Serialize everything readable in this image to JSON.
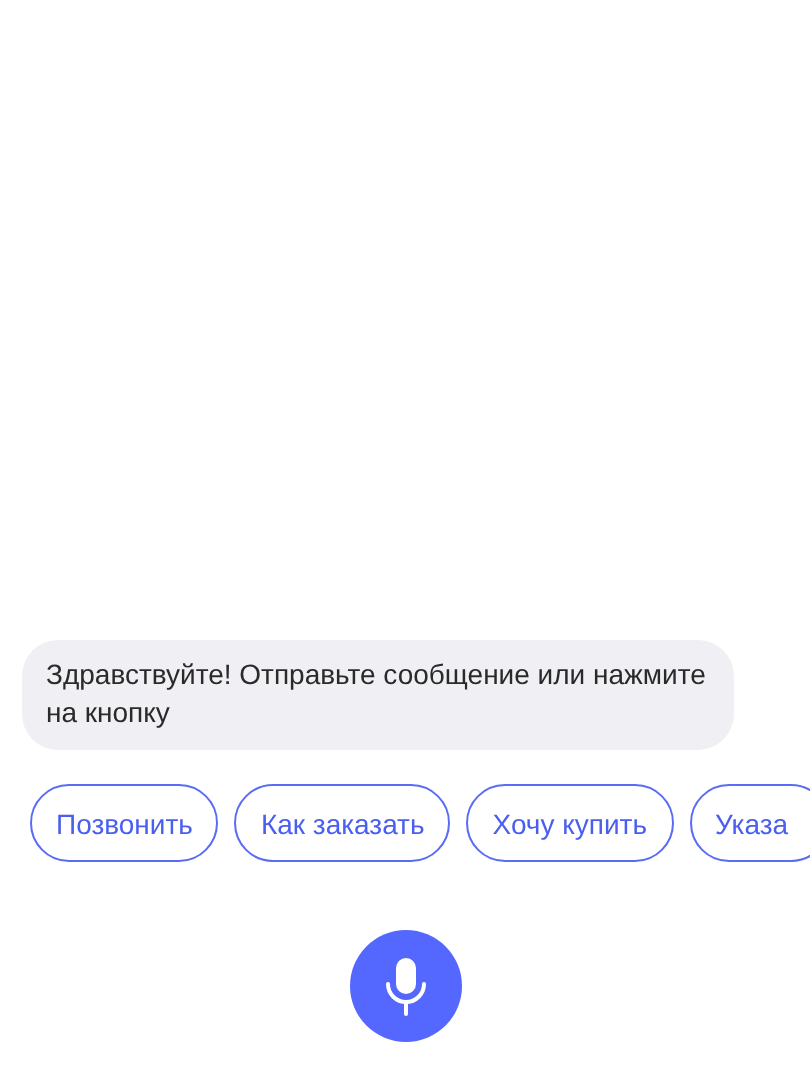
{
  "message": {
    "text": "Здравствуйте! Отправьте сообщение или нажмите на кнопку"
  },
  "quick_replies": [
    {
      "label": "Позвонить"
    },
    {
      "label": "Как заказать"
    },
    {
      "label": "Хочу купить"
    },
    {
      "label": "Указа"
    }
  ]
}
